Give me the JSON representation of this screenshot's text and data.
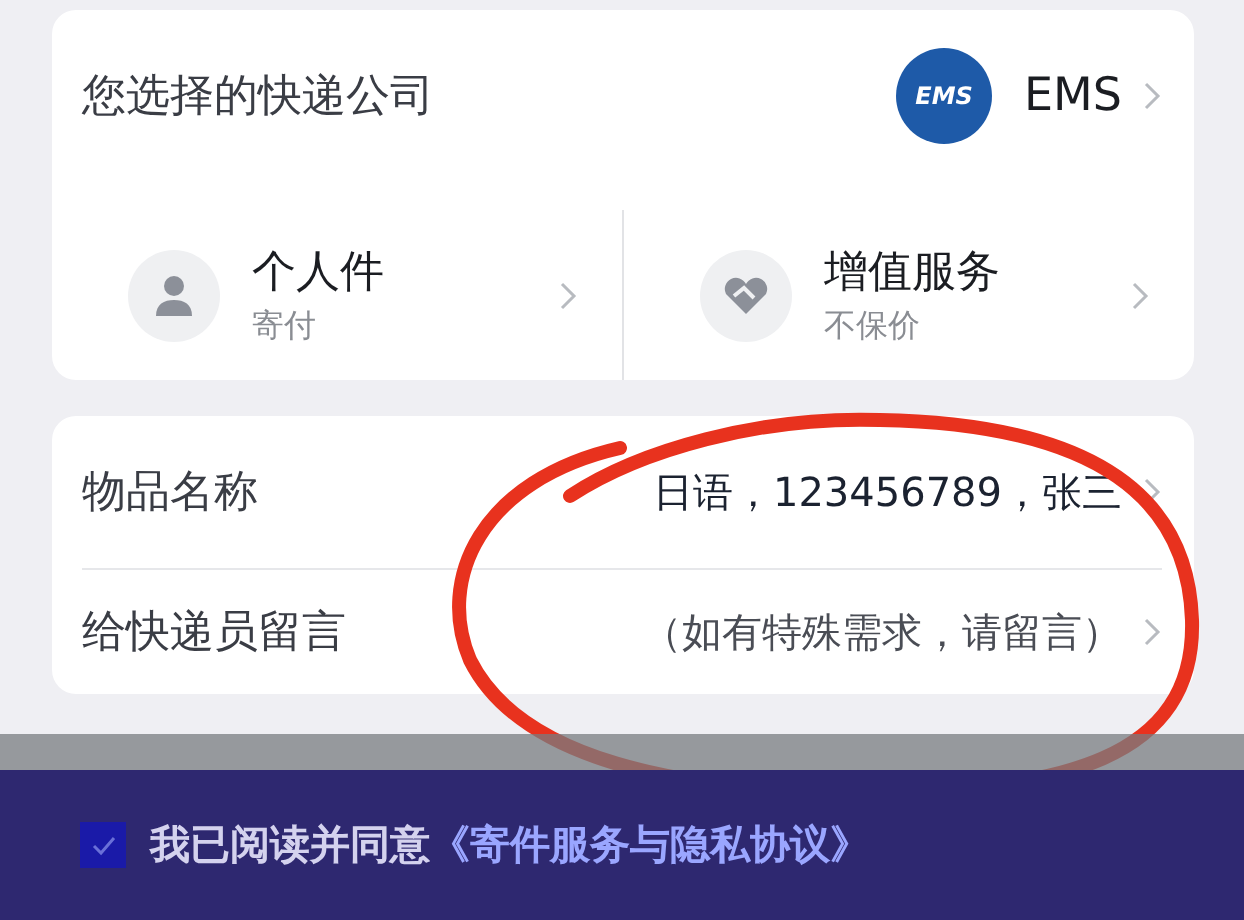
{
  "courier": {
    "label": "您选择的快递公司",
    "logo": "EMS",
    "name": "EMS"
  },
  "services": [
    {
      "kind": "person",
      "title": "个人件",
      "subtitle": "寄付"
    },
    {
      "kind": "heart",
      "title": "增值服务",
      "subtitle": "不保价"
    }
  ],
  "fields": [
    {
      "label": "物品名称",
      "value": "日语，123456789，张三"
    },
    {
      "label": "给快递员留言",
      "placeholder": "（如有特殊需求，请留言）"
    }
  ],
  "agreement": {
    "checked": true,
    "text": "我已阅读并同意",
    "link": "《寄件服务与隐私协议》"
  }
}
